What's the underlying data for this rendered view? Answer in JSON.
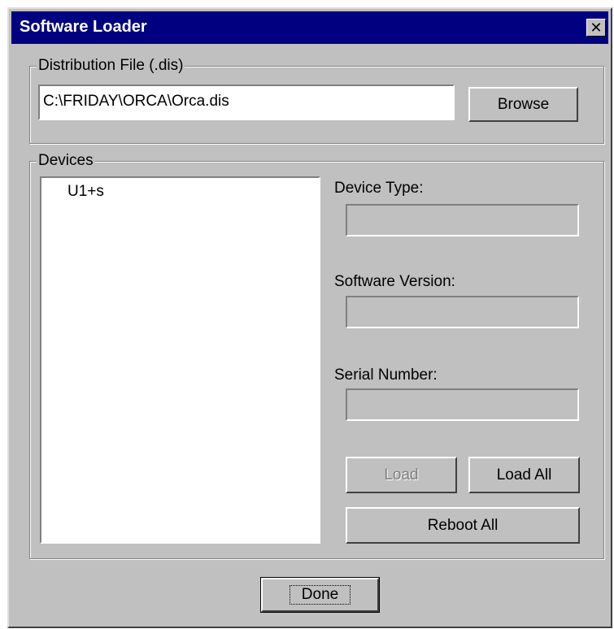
{
  "window": {
    "title": "Software Loader",
    "close_glyph": "✕",
    "close_icon": "close-icon"
  },
  "distribution": {
    "group_label": "Distribution File (.dis)",
    "file_path": "C:\\FRIDAY\\ORCA\\Orca.dis",
    "browse_label": "Browse"
  },
  "devices": {
    "group_label": "Devices",
    "list": [
      "U1+s"
    ],
    "device_type_label": "Device Type:",
    "device_type_value": "",
    "software_version_label": "Software Version:",
    "software_version_value": "",
    "serial_number_label": "Serial Number:",
    "serial_number_value": "",
    "load_label": "Load",
    "load_all_label": "Load All",
    "reboot_all_label": "Reboot All"
  },
  "footer": {
    "done_label": "Done"
  }
}
